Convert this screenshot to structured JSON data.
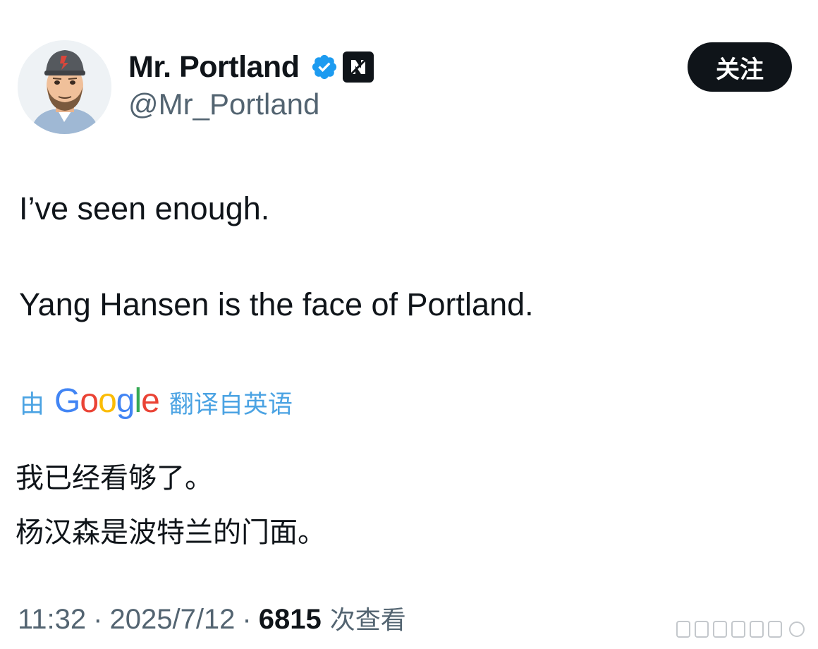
{
  "author": {
    "display_name": "Mr. Portland",
    "handle": "@Mr_Portland",
    "verified": true,
    "icons": [
      "avatar-cartoon-man",
      "verified-check-icon",
      "affiliate-badge-icon"
    ]
  },
  "follow_button": {
    "label": "关注"
  },
  "tweet": {
    "line1": "I’ve seen enough.",
    "line2": "Yang Hansen is the face of Portland."
  },
  "translation": {
    "prefix": "由",
    "provider": "Google",
    "suffix": "翻译自英语",
    "lines": [
      "我已经看够了。",
      "杨汉森是波特兰的门面。"
    ]
  },
  "meta": {
    "time": "11:32",
    "separator": "·",
    "date": "2025/7/12",
    "views": "6815",
    "views_label": "次查看"
  },
  "colors": {
    "text": "#0f1419",
    "secondary": "#536471",
    "link": "#4ba3e3",
    "verified": "#1d9bf0",
    "button_bg": "#0f1419",
    "google_blue": "#4285F4",
    "google_red": "#EA4335",
    "google_yellow": "#FBBC05",
    "google_green": "#34A853"
  }
}
